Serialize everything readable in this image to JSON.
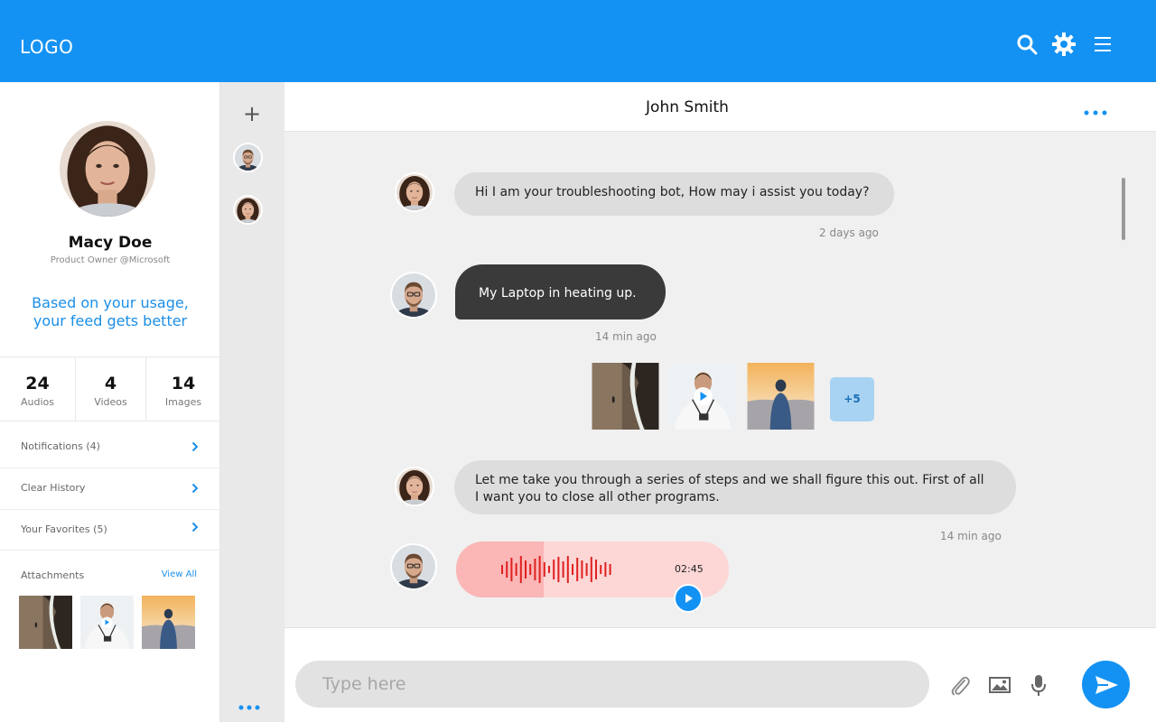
{
  "header": {
    "logo": "LOGO",
    "icons": [
      "search-icon",
      "gear-icon",
      "menu-icon"
    ],
    "color": "#1492f3"
  },
  "profile": {
    "name": "Macy Doe",
    "role": "Product Owner @Microsoft",
    "feed_line1": "Based on your usage,",
    "feed_line2": "your feed gets better",
    "stats": [
      {
        "value": "24",
        "label": "Audios"
      },
      {
        "value": "4",
        "label": "Videos"
      },
      {
        "value": "14",
        "label": "Images"
      }
    ],
    "menu": [
      {
        "label": "Notifications (4)"
      },
      {
        "label": "Clear History"
      },
      {
        "label": "Your Favorites (5)"
      }
    ],
    "attachments_label": "Attachments",
    "view_all_label": "View All"
  },
  "rail": {
    "add_label": "+"
  },
  "chat": {
    "title": "John Smith",
    "messages": [
      {
        "from": "bot",
        "text": "Hi I am your troubleshooting bot, How may i assist you today?",
        "time": "2 days ago"
      },
      {
        "from": "user",
        "text": "My Laptop in heating up.",
        "time": "14  min ago"
      },
      {
        "from": "bot",
        "text_line1": "Let me take you through a series of steps and we shall figure this out. First of all",
        "text_line2": "I want you to close all other programs.",
        "time": "14  min ago"
      }
    ],
    "media_more": "+5",
    "audio": {
      "duration": "02:45",
      "progress": 0.32
    }
  },
  "composer": {
    "placeholder": "Type here",
    "icons": [
      "paperclip-icon",
      "image-icon",
      "microphone-icon",
      "send-icon"
    ]
  },
  "colors": {
    "accent": "#1492f3",
    "bubble_in": "#dddddd",
    "bubble_out": "#3a3a3a",
    "audio": "#fdd6d6",
    "waveform": "#e02020"
  }
}
